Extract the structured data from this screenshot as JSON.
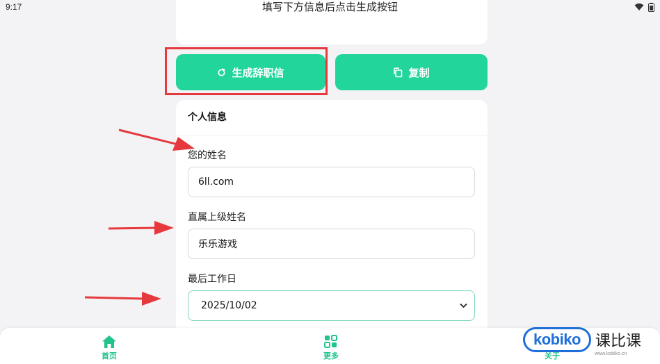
{
  "status_bar": {
    "time": "9:17"
  },
  "page_hint": "填写下方信息后点击生成按钮",
  "actions": {
    "generate_label": "生成辞职信",
    "copy_label": "复制",
    "accent_color": "#22d59a",
    "highlight_color": "#e5393e"
  },
  "form": {
    "title": "个人信息",
    "name_label": "您的姓名",
    "name_value": "6ll.com",
    "supervisor_label": "直属上级姓名",
    "supervisor_value": "乐乐游戏",
    "last_day_label": "最后工作日",
    "last_day_value": "2025/10/02"
  },
  "bottom_nav": {
    "items": [
      {
        "label": "首页",
        "icon": "home-icon"
      },
      {
        "label": "更多",
        "icon": "apps-icon"
      },
      {
        "label": "关于",
        "icon": "info-icon"
      }
    ]
  },
  "watermark": {
    "brand": "kobiko",
    "brand_cn": "课比课",
    "domain": "www.kobiko.cn"
  }
}
